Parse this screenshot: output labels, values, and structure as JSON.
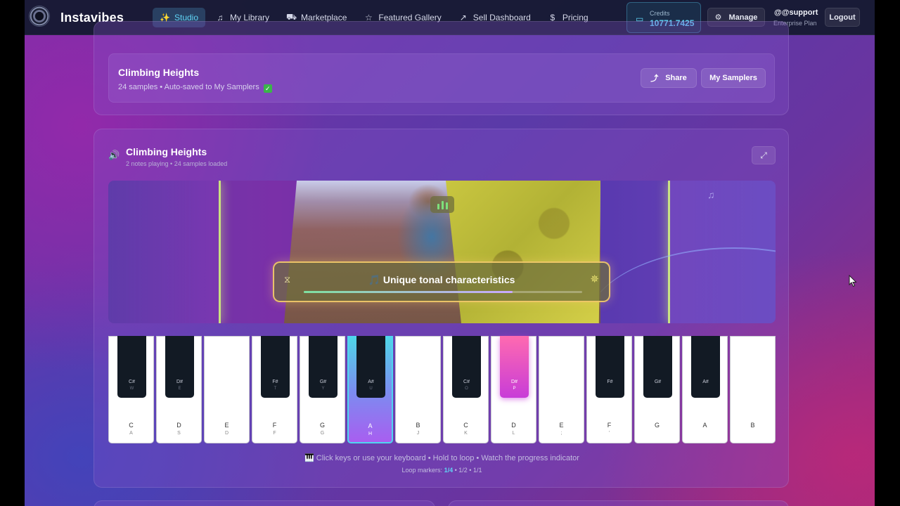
{
  "app": {
    "brand": "Instavibes"
  },
  "nav": {
    "links": [
      {
        "label": "Studio",
        "icon": "wand-icon",
        "active": true
      },
      {
        "label": "My Library",
        "icon": "music-note-icon"
      },
      {
        "label": "Marketplace",
        "icon": "cart-icon"
      },
      {
        "label": "Featured Gallery",
        "icon": "star-icon"
      },
      {
        "label": "Sell Dashboard",
        "icon": "trend-icon"
      },
      {
        "label": "Pricing",
        "icon": "dollar-icon"
      }
    ],
    "credits_label": "Credits",
    "credits_value": "10771.7425",
    "manage_label": "Manage",
    "user_name": "@@support",
    "user_plan": "Enterprise Plan",
    "logout_label": "Logout"
  },
  "project": {
    "title": "Climbing Heights",
    "subtitle": "24 samples • Auto-saved to My Samplers",
    "share_label": "Share",
    "samplers_label": "My Samplers"
  },
  "player": {
    "title": "Climbing Heights",
    "subtitle": "2 notes playing • 24 samples loaded",
    "caption": "🎵 Unique tonal characteristics",
    "caption_progress": 0.75,
    "hint": "🎹 Click keys or use your keyboard • Hold to loop • Watch the progress indicator",
    "markers_label": "Loop markers:",
    "markers": [
      "1/4",
      "1/2",
      "1/1"
    ],
    "markers_selected": "1/4"
  },
  "piano": {
    "white_keys": [
      {
        "note": "C",
        "key": "A"
      },
      {
        "note": "D",
        "key": "S"
      },
      {
        "note": "E",
        "key": "D"
      },
      {
        "note": "F",
        "key": "F"
      },
      {
        "note": "G",
        "key": "G"
      },
      {
        "note": "A",
        "key": "H",
        "active": true
      },
      {
        "note": "B",
        "key": "J"
      },
      {
        "note": "C",
        "key": "K"
      },
      {
        "note": "D",
        "key": "L"
      },
      {
        "note": "E",
        "key": ";"
      },
      {
        "note": "F",
        "key": "'"
      },
      {
        "note": "G",
        "key": ""
      },
      {
        "note": "A",
        "key": ""
      },
      {
        "note": "B",
        "key": ""
      }
    ],
    "black_keys": [
      {
        "note": "C#",
        "key": "W",
        "after_white": 0
      },
      {
        "note": "D#",
        "key": "E",
        "after_white": 1
      },
      {
        "note": "F#",
        "key": "T",
        "after_white": 3
      },
      {
        "note": "G#",
        "key": "Y",
        "after_white": 4
      },
      {
        "note": "A#",
        "key": "U",
        "after_white": 5
      },
      {
        "note": "C#",
        "key": "O",
        "after_white": 7
      },
      {
        "note": "D#",
        "key": "P",
        "after_white": 8,
        "active": true
      },
      {
        "note": "F#",
        "key": "",
        "after_white": 10
      },
      {
        "note": "G#",
        "key": "",
        "after_white": 11
      },
      {
        "note": "A#",
        "key": "",
        "after_white": 12
      }
    ]
  },
  "colors": {
    "accent": "#5fd3f5",
    "active_black": "#e04cc8",
    "active_white": "#8a7af0"
  }
}
